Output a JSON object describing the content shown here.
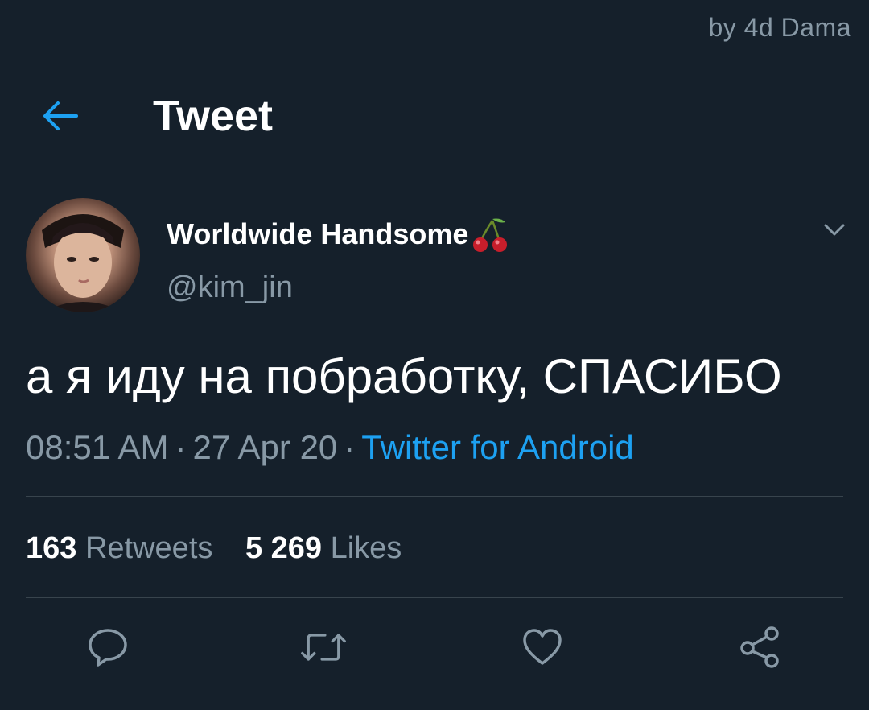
{
  "watermark": "by 4d Dama",
  "header": {
    "back_icon": "arrow-left-icon",
    "title": "Tweet"
  },
  "author": {
    "name": "Worldwide Handsome",
    "name_emoji": "cherries-icon",
    "handle": "@kim_jin"
  },
  "tweet": {
    "text": "а я иду на побработку, СПАСИБО",
    "time": "08:51 AM",
    "date": "27 Apr 20",
    "separator": "·",
    "source": "Twitter for Android"
  },
  "stats": {
    "retweets_count": "163",
    "retweets_label": "Retweets",
    "likes_count": "5 269",
    "likes_label": "Likes"
  },
  "actions": [
    "reply-icon",
    "retweet-icon",
    "like-icon",
    "share-icon"
  ],
  "colors": {
    "background": "#15202b",
    "accent": "#1da1f2",
    "secondary_text": "#8899a6",
    "divider": "#38444d"
  }
}
